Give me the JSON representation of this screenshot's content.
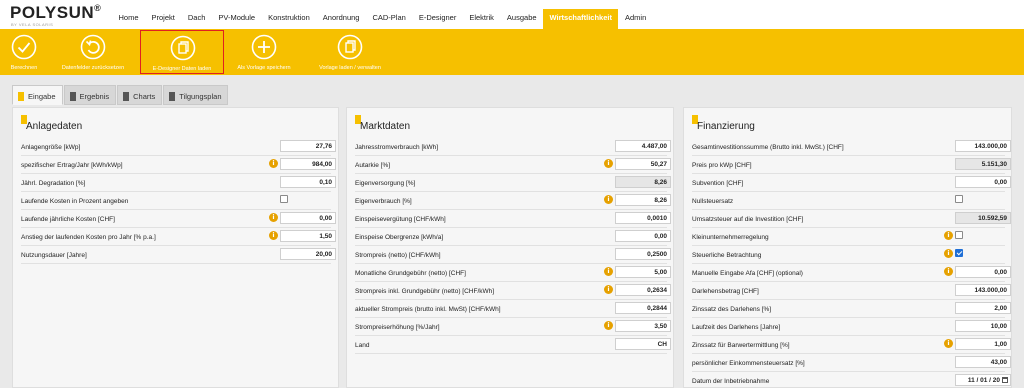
{
  "app": {
    "logo": "POLYSUN",
    "logo_reg": "®",
    "logo_sub": "BY VELA SOLARIS"
  },
  "nav": [
    {
      "label": "Home",
      "active": false
    },
    {
      "label": "Projekt",
      "active": false
    },
    {
      "label": "Dach",
      "active": false
    },
    {
      "label": "PV-Module",
      "active": false
    },
    {
      "label": "Konstruktion",
      "active": false
    },
    {
      "label": "Anordnung",
      "active": false
    },
    {
      "label": "CAD-Plan",
      "active": false
    },
    {
      "label": "E-Designer",
      "active": false
    },
    {
      "label": "Elektrik",
      "active": false
    },
    {
      "label": "Ausgabe",
      "active": false
    },
    {
      "label": "Wirtschaftlichkeit",
      "active": true
    },
    {
      "label": "Admin",
      "active": false
    }
  ],
  "toolbar": [
    {
      "label": "Berechnen",
      "icon": "check-circle-icon"
    },
    {
      "label": "Datenfelder zurücksetzen",
      "icon": "reset-circle-icon"
    },
    {
      "label": "E-Designer Daten laden",
      "icon": "copy-circle-icon",
      "highlighted": true
    },
    {
      "label": "Als Vorlage speichern",
      "icon": "plus-circle-icon"
    },
    {
      "label": "Vorlage laden / verwalten",
      "icon": "copy-circle-icon"
    }
  ],
  "tabs": [
    {
      "label": "Eingabe",
      "active": true
    },
    {
      "label": "Ergebnis",
      "active": false
    },
    {
      "label": "Charts",
      "active": false
    },
    {
      "label": "Tilgungsplan",
      "active": false
    }
  ],
  "panels": [
    {
      "title": "Anlagedaten",
      "rows": [
        {
          "label": "Anlagengröße [kWp]",
          "value": "27,76",
          "info": false,
          "type": "input"
        },
        {
          "label": "spezifischer Ertrag/Jahr [kWh/kWp]",
          "value": "984,00",
          "info": true,
          "type": "input"
        },
        {
          "label": "Jährl. Degradation [%]",
          "value": "0,10",
          "info": false,
          "type": "input"
        },
        {
          "label": "Laufende Kosten in Prozent angeben",
          "info": false,
          "type": "checkbox",
          "checked": false
        },
        {
          "label": "Laufende jährliche Kosten [CHF]",
          "value": "0,00",
          "info": true,
          "type": "input"
        },
        {
          "label": "Anstieg der laufenden Kosten pro Jahr [% p.a.]",
          "value": "1,50",
          "info": true,
          "type": "input"
        },
        {
          "label": "Nutzungsdauer [Jahre]",
          "value": "20,00",
          "info": false,
          "type": "input"
        }
      ]
    },
    {
      "title": "Marktdaten",
      "rows": [
        {
          "label": "Jahresstromverbrauch [kWh]",
          "value": "4.487,00",
          "info": false,
          "type": "input"
        },
        {
          "label": "Autarkie [%]",
          "value": "50,27",
          "info": true,
          "type": "input"
        },
        {
          "label": "Eigenversorgung [%]",
          "value": "8,26",
          "info": false,
          "type": "readonly"
        },
        {
          "label": "Eigenverbrauch [%]",
          "value": "8,26",
          "info": true,
          "type": "input"
        },
        {
          "label": "Einspeisevergütung [CHF/kWh]",
          "value": "0,0010",
          "info": false,
          "type": "input"
        },
        {
          "label": "Einspeise Obergrenze [kWh/a]",
          "value": "0,00",
          "info": false,
          "type": "input"
        },
        {
          "label": "Strompreis (netto) [CHF/kWh]",
          "value": "0,2500",
          "info": false,
          "type": "input"
        },
        {
          "label": "Monatliche Grundgebühr (netto) [CHF]",
          "value": "5,00",
          "info": true,
          "type": "input"
        },
        {
          "label": "Strompreis inkl. Grundgebühr (netto) [CHF/kWh]",
          "value": "0,2634",
          "info": true,
          "type": "input"
        },
        {
          "label": "aktueller Strompreis (brutto inkl. MwSt) [CHF/kWh]",
          "value": "0,2844",
          "info": false,
          "type": "input"
        },
        {
          "label": "Strompreiserhöhung [%/Jahr]",
          "value": "3,50",
          "info": true,
          "type": "input"
        },
        {
          "label": "Land",
          "value": "CH",
          "info": false,
          "type": "input"
        }
      ]
    },
    {
      "title": "Finanzierung",
      "rows": [
        {
          "label": "Gesamtinvestitionssumme (Brutto inkl. MwSt.) [CHF]",
          "value": "143.000,00",
          "info": false,
          "type": "input"
        },
        {
          "label": "Preis pro kWp [CHF]",
          "value": "5.151,30",
          "info": false,
          "type": "readonly"
        },
        {
          "label": "Subvention [CHF]",
          "value": "0,00",
          "info": false,
          "type": "input"
        },
        {
          "label": "Nullsteuersatz",
          "info": false,
          "type": "checkbox",
          "checked": false
        },
        {
          "label": "Umsatzsteuer auf die Investition [CHF]",
          "value": "10.592,59",
          "info": false,
          "type": "readonly"
        },
        {
          "label": "Kleinunternehmerregelung",
          "info": true,
          "type": "checkbox",
          "checked": false
        },
        {
          "label": "Steuerliche Betrachtung",
          "info": true,
          "type": "checkbox",
          "checked": true
        },
        {
          "label": "Manuelle Eingabe Afa [CHF] (optional)",
          "value": "0,00",
          "info": true,
          "type": "input"
        },
        {
          "label": "Darlehensbetrag [CHF]",
          "value": "143.000,00",
          "info": false,
          "type": "input"
        },
        {
          "label": "Zinssatz des Darlehens [%]",
          "value": "2,00",
          "info": false,
          "type": "input"
        },
        {
          "label": "Laufzeit des Darlehens [Jahre]",
          "value": "10,00",
          "info": false,
          "type": "input"
        },
        {
          "label": "Zinssatz für Barwertermittlung [%]",
          "value": "1,00",
          "info": true,
          "type": "input"
        },
        {
          "label": "persönlicher Einkommensteuersatz [%]",
          "value": "43,00",
          "info": false,
          "type": "input"
        },
        {
          "label": "Datum der Inbetriebnahme",
          "value": "11 / 01 / 20",
          "info": false,
          "type": "date"
        }
      ]
    }
  ]
}
